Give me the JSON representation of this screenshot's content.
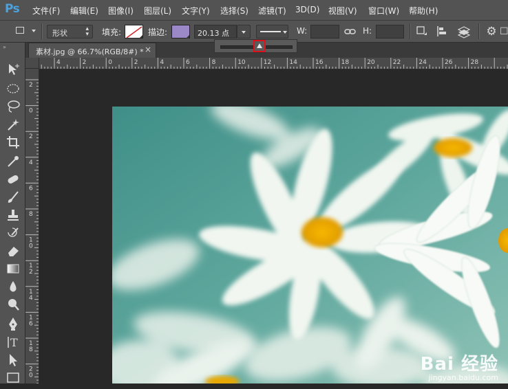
{
  "app": {
    "logo": "Ps"
  },
  "menu": [
    "文件(F)",
    "编辑(E)",
    "图像(I)",
    "图层(L)",
    "文字(Y)",
    "选择(S)",
    "滤镜(T)",
    "3D(D)",
    "视图(V)",
    "窗口(W)",
    "帮助(H)"
  ],
  "options": {
    "mode_value": "形状",
    "fill_label": "填充:",
    "stroke_label": "描边:",
    "stroke_color": "#9a88c7",
    "stroke_width": "20.13 点",
    "w_label": "W:",
    "h_label": "H:"
  },
  "stroke_slider": {
    "value_fraction": 0.55
  },
  "document": {
    "tab_title": "素材.jpg @ 66.7%(RGB/8#) *",
    "close_glyph": "×"
  },
  "ruler": {
    "h_ticks": [
      "4",
      "2",
      "0",
      "2",
      "4",
      "6",
      "8",
      "10",
      "12",
      "14",
      "16",
      "18",
      "20",
      "22",
      "24",
      "26",
      "28"
    ],
    "v_ticks": [
      "2",
      "0",
      "2",
      "4",
      "6",
      "8",
      "10",
      "12",
      "14",
      "16",
      "18",
      "20"
    ]
  },
  "watermark": {
    "brand": "Bai 经验",
    "url": "jingyan.baidu.com"
  },
  "colors": {
    "accent_logo": "#4aa3df",
    "highlight": "#e0101b",
    "canvas_teal": "#4a9a91"
  }
}
